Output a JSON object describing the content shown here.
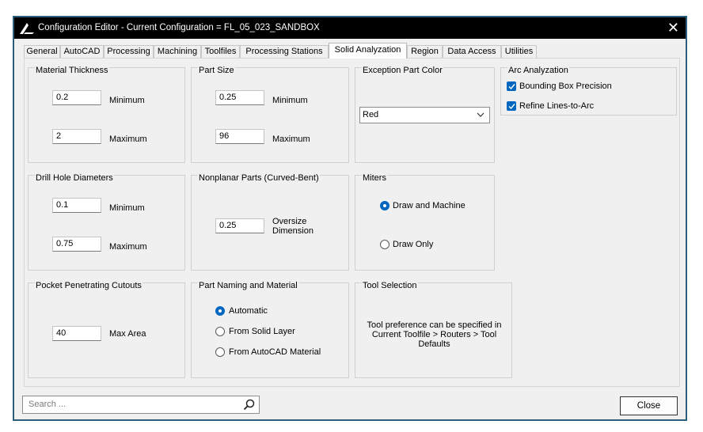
{
  "window": {
    "title": "Configuration Editor - Current Configuration = FL_05_023_SANDBOX",
    "close_glyph": "✕"
  },
  "tabs": [
    {
      "label": "General"
    },
    {
      "label": "AutoCAD"
    },
    {
      "label": "Processing"
    },
    {
      "label": "Machining"
    },
    {
      "label": "Toolfiles"
    },
    {
      "label": "Processing Stations"
    },
    {
      "label": "Solid Analyzation"
    },
    {
      "label": "Region"
    },
    {
      "label": "Data Access"
    },
    {
      "label": "Utilities"
    }
  ],
  "active_tab": "Solid Analyzation",
  "material_thickness": {
    "title": "Material Thickness",
    "min_value": "0.2",
    "min_label": "Minimum",
    "max_value": "2",
    "max_label": "Maximum"
  },
  "part_size": {
    "title": "Part Size",
    "min_value": "0.25",
    "min_label": "Minimum",
    "max_value": "96",
    "max_label": "Maximum"
  },
  "exception_color": {
    "title": "Exception Part Color",
    "selected": "Red"
  },
  "arc_analyzation": {
    "title": "Arc Analyzation",
    "bounding_box": {
      "label": "Bounding Box Precision",
      "checked": true
    },
    "refine_lines": {
      "label": "Refine Lines-to-Arc",
      "checked": true
    }
  },
  "drill_hole": {
    "title": "Drill Hole Diameters",
    "min_value": "0.1",
    "min_label": "Minimum",
    "max_value": "0.75",
    "max_label": "Maximum"
  },
  "nonplanar": {
    "title": "Nonplanar Parts  (Curved-Bent)",
    "value": "0.25",
    "label_line1": "Oversize",
    "label_line2": "Dimension"
  },
  "miters": {
    "title": "Miters",
    "option1": "Draw and Machine",
    "option2": "Draw Only",
    "selected": "Draw and Machine"
  },
  "pocket": {
    "title": "Pocket Penetrating Cutouts",
    "value": "40",
    "label": "Max Area"
  },
  "part_naming": {
    "title": "Part Naming and Material",
    "option1": "Automatic",
    "option2": "From Solid Layer",
    "option3": "From AutoCAD Material",
    "selected": "Automatic"
  },
  "tool_selection": {
    "title": "Tool Selection",
    "line1": "Tool preference can be specified in",
    "line2": "Current Toolfile > Routers > Tool",
    "line3": "Defaults"
  },
  "footer": {
    "search_placeholder": "Search ...",
    "close_label": "Close"
  },
  "colors": {
    "titlebar": "#000000",
    "accent": "#0067c0",
    "window_border": "#2c5d7c"
  }
}
